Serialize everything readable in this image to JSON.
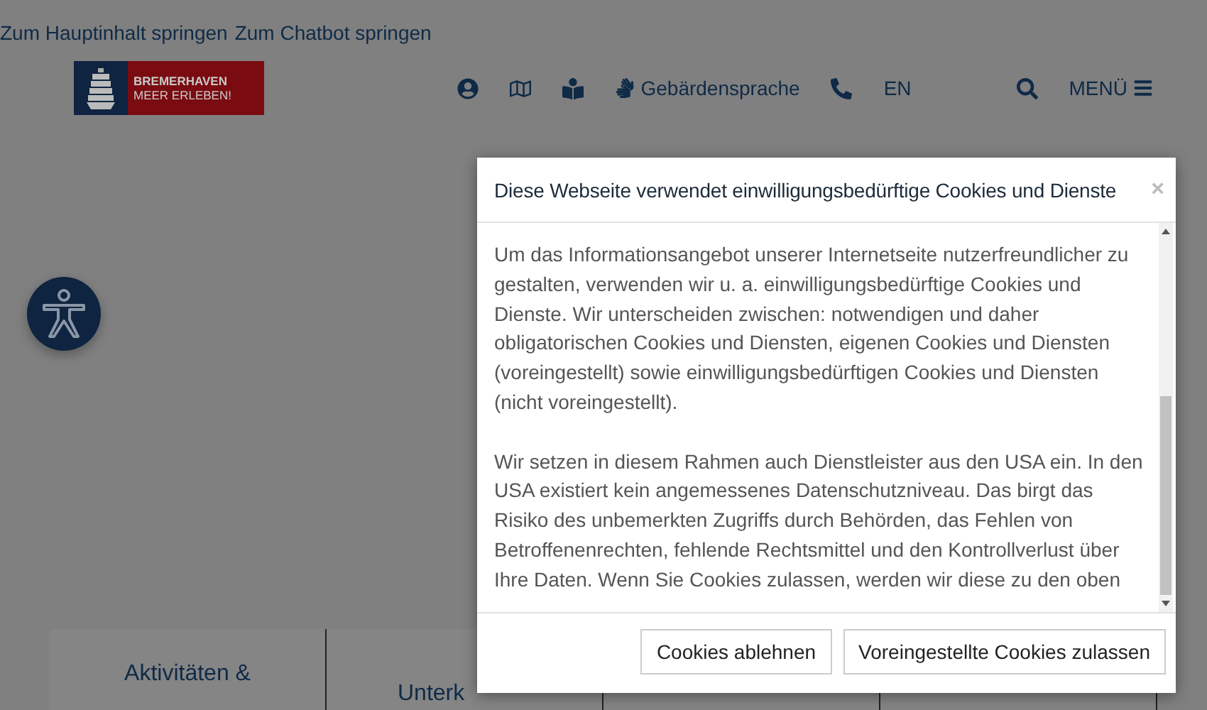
{
  "skip_links": [
    "Zum Hauptinhalt springen",
    "Zum Chatbot springen"
  ],
  "logo": {
    "line_1": "BREMERHAVEN",
    "line_2": "MEER ERLEBEN!"
  },
  "header_nav": [
    {
      "kind": "icon"
    },
    {
      "kind": "icon"
    },
    {
      "kind": "icon"
    },
    {
      "kind": "text",
      "label": "Gebärdensprache"
    },
    {
      "kind": "icon"
    },
    {
      "kind": "text",
      "label": "EN"
    }
  ],
  "menu": {
    "label": "MENÜ"
  },
  "tile_labels": [
    "Aktivitäten &",
    "Unterk"
  ],
  "cookie_dialog": {
    "title": "Diese Webseite verwendet einwilligungsbedürftige Cookies und Dienste",
    "close": "×",
    "paragraphs": [
      "Um das Informationsangebot unserer Internetseite nutzerfreundlicher zu gestalten, verwenden wir u. a. einwilligungsbedürftige Cookies und Dienste. Wir unterscheiden zwischen: notwendigen und daher obligatorischen Cookies und Diensten, eigenen Cookies und Diensten (voreingestellt) sowie einwilligungsbedürftigen Cookies und Diensten (nicht voreingestellt).",
      "Wir setzen in diesem Rahmen auch Dienstleister aus den USA ein. In den USA existiert kein angemessenes Datenschutzniveau. Das birgt das Risiko des unbemerkten Zugriffs durch Behörden, das Fehlen von Betroffenenrechten, fehlende Rechtsmittel und den Kontrollverlust über Ihre Daten. Wenn Sie Cookies zulassen, werden wir diese zu den oben"
    ],
    "buttons": [
      "Cookies ablehnen",
      "Voreingestellte Cookies zulassen"
    ]
  }
}
